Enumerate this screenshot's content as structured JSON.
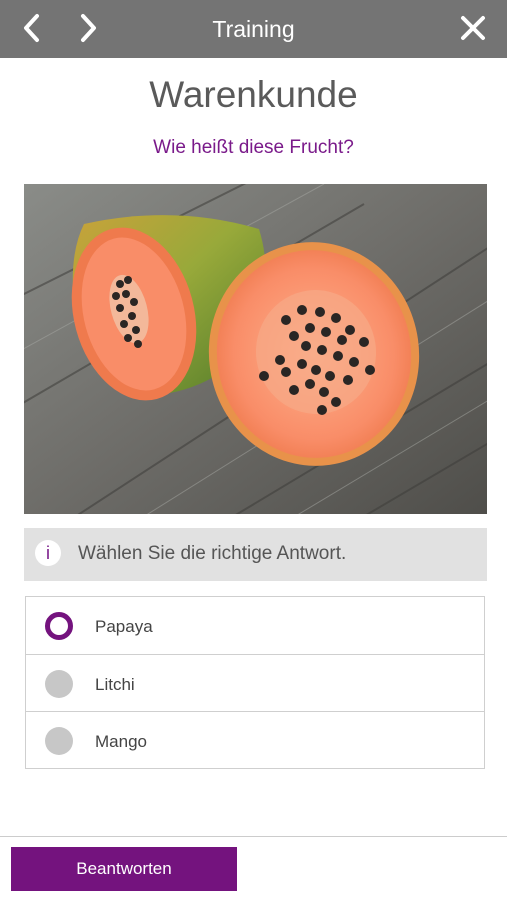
{
  "header": {
    "title": "Training",
    "back_icon": "chevron-left-icon",
    "forward_icon": "chevron-right-icon",
    "close_icon": "close-icon"
  },
  "page": {
    "title": "Warenkunde",
    "question": "Wie heißt diese Frucht?"
  },
  "image": {
    "subject": "papaya-halves-on-wooden-table"
  },
  "info": {
    "icon_label": "i",
    "text": "Wählen Sie die richtige Antwort."
  },
  "options": [
    {
      "label": "Papaya",
      "selected": true
    },
    {
      "label": "Litchi",
      "selected": false
    },
    {
      "label": "Mango",
      "selected": false
    }
  ],
  "footer": {
    "submit_label": "Beantworten"
  },
  "colors": {
    "accent": "#74137e",
    "header_bg": "#747474",
    "info_bg": "#e1e1e1"
  }
}
